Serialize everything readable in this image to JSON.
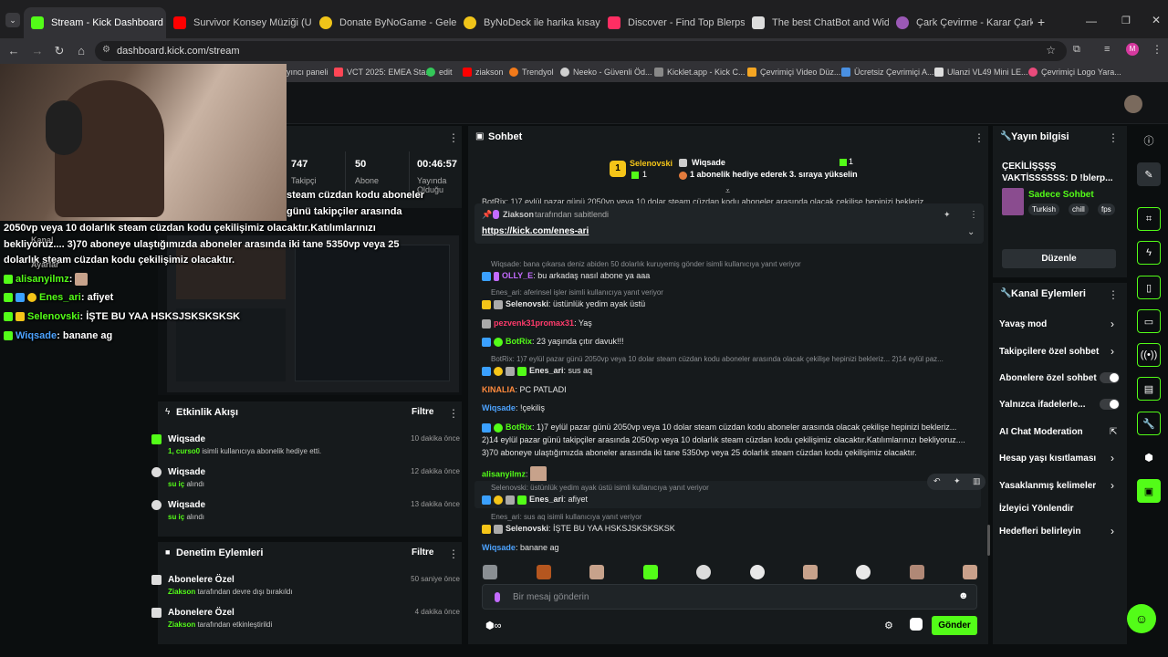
{
  "browser": {
    "tabs": [
      {
        "label": "Stream - Kick Dashboard",
        "color": "#53fc18"
      },
      {
        "label": "Survivor Konsey Müziği (Uz",
        "color": "#ff0000"
      },
      {
        "label": "Donate ByNoGame - Gelen/Gi",
        "color": "#f0c419"
      },
      {
        "label": "ByNoDeck ile harika kısayollar",
        "color": "#f0c419"
      },
      {
        "label": "Discover - Find Top Blerps, Stre",
        "color": "#ff2e63"
      },
      {
        "label": "The best ChatBot and Widgets",
        "color": "#dddddd"
      },
      {
        "label": "Çark Çevirme - Karar Çarkı!",
        "color": "#9b59b6"
      }
    ],
    "url": "dashboard.kick.com/stream",
    "bookmarks": [
      "yıncı paneli",
      "VCT 2025: EMEA Sta...",
      "edit",
      "ziakson",
      "Trendyol",
      "Neeko - Güvenli Öd...",
      "Kicklet.app - Kick C...",
      "Çevrimiçi Video Düz...",
      "Ücretsiz Çevrimiçi A...",
      "Ulanzi VL49 Mini LE...",
      "Çevrimiçi Logo Yara..."
    ]
  },
  "stats": {
    "followers_value": "747",
    "followers_label": "Takipçi",
    "subs_value": "50",
    "subs_label": "Abone",
    "uptime_value": "00:46:57",
    "uptime_label": "Yayında",
    "uptime_sub": "Olduğu"
  },
  "stream_overlay": {
    "line0": "steam cüzdan kodu aboneler",
    "line1": "günü takipçiler arasında",
    "line2": "2050vp veya 10 dolarlık steam cüzdan kodu çekilişimiz olacaktır.Katılımlarınızı",
    "line3": "bekliyoruz.... 3)70 aboneye ulaştığımızda aboneler arasında iki tane 5350vp veya 25",
    "line4": "dolarlık steam cüzdan kodu çekilişimiz olacaktır.",
    "ghost1": "Kanal",
    "ghost2": "Ayarlar",
    "chat": [
      {
        "user": "alisanyilmz",
        "text": ":",
        "color": "#53fc18"
      },
      {
        "user": "Enes_ari",
        "text": ": afiyet",
        "color": "#53fc18"
      },
      {
        "user": "Selenovski",
        "text": ": İŞTE BU YAA HSKSJSKSKSKSK",
        "color": "#53fc18"
      },
      {
        "user": "Wiqsade",
        "text": ": banane ag",
        "color": "#4da3ff"
      }
    ]
  },
  "activity": {
    "title": "Etkinlik Akışı",
    "filter": "Filtre",
    "items": [
      {
        "name": "Wiqsade",
        "sub_b": "1, curso0",
        "sub": " isimli kullanıcıya abonelik hediye etti.",
        "time": "10 dakika önce"
      },
      {
        "name": "Wiqsade",
        "sub_b": "su iç",
        "sub": " alındı",
        "time": "12 dakika önce"
      },
      {
        "name": "Wiqsade",
        "sub_b": "su iç",
        "sub": " alındı",
        "time": "13 dakika önce"
      }
    ]
  },
  "moderation": {
    "title": "Denetim Eylemleri",
    "filter": "Filtre",
    "items": [
      {
        "name": "Abonelere Özel",
        "sub_b": "Ziakson",
        "sub": " tarafından devre dışı bırakıldı",
        "time": "50 saniye önce"
      },
      {
        "name": "Abonelere Özel",
        "sub_b": "Ziakson",
        "sub": " tarafından etkinleştirildi",
        "time": "4 dakika önce"
      }
    ]
  },
  "chat": {
    "title": "Sohbet",
    "leader_user": "Selenovski",
    "leader_count": "1",
    "gifter_user": "Wiqsade",
    "gifter_count": "1",
    "gifter_text": "1 abonelik hediye ederek 3. sıraya yükselin",
    "pinned_by": "Ziakson",
    "pinned_suffix": "tarafından sabitlendi",
    "pinned_link": "https://kick.com/enes-ari",
    "top_cut": "BotRix: 1)7 eylül pazar günü 2050vp veya 10 dolar steam cüzdan kodu aboneler arasında olacak çekilişe hepinizi bekleriz...",
    "messages": [
      {
        "reply": "Wiqsade: bana çıkarsa deniz abiden 50 dolarlık kuruyemiş gönder isimli kullanıcıya yanıt veriyor",
        "user": "OLLY_E",
        "color": "#c36bff",
        "text": ": bu arkadaş nasıl abone ya aaa"
      },
      {
        "reply": "Enes_ari: aferinsel işler isimli kullanıcıya yanıt veriyor",
        "user": "Selenovski",
        "color": "#ffffff",
        "text": ": üstünlük yedim ayak üstü"
      },
      {
        "reply": "",
        "user": "pezvenk31promax31",
        "color": "#ff3b6b",
        "text": ": Yaş"
      },
      {
        "reply": "",
        "user": "BotRix",
        "color": "#53fc18",
        "text": ": 23 yaşında çıtır davuk!!!"
      },
      {
        "reply": "BotRix: 1)7 eylül pazar günü 2050vp veya 10 dolar steam cüzdan kodu aboneler arasında olacak çekilişe hepinizi bekleriz... 2)14 eylül paz...",
        "user": "Enes_ari",
        "color": "#ffffff",
        "text": ": sus aq"
      },
      {
        "reply": "",
        "user": "KINALIA",
        "color": "#ff8a3d",
        "text": ": PC PATLADI"
      },
      {
        "reply": "",
        "user": "Wiqsade",
        "color": "#4da3ff",
        "text": ": !çekiliş"
      }
    ],
    "botrix_long_user": "BotRix",
    "botrix_long_1": ": 1)7 eylül pazar günü 2050vp veya 10 dolar steam cüzdan kodu aboneler arasında olacak çekilişe hepinizi bekleriz...",
    "botrix_long_2": "2)14 eylül pazar günü takipçiler arasında 2050vp veya 10 dolarlık steam cüzdan kodu çekilişimiz olacaktır.Katılımlarınızı bekliyoruz....",
    "botrix_long_3": "3)70 aboneye ulaştığımızda aboneler arasında iki tane 5350vp veya 25 dolarlık steam cüzdan kodu çekilişimiz olacaktır.",
    "tail": [
      {
        "reply": "",
        "user": "alisanyilmz",
        "color": "#53fc18",
        "text": ":"
      },
      {
        "reply": "Selenovski: üstünlük yedim ayak üstü isimli kullanıcıya yanıt veriyor",
        "user": "Enes_ari",
        "color": "#ffffff",
        "text": ": afiyet"
      },
      {
        "reply": "Enes_ari: sus aq isimli kullanıcıya yanıt veriyor",
        "user": "Selenovski",
        "color": "#ffffff",
        "text": ": İŞTE BU YAA HSKSJSKSKSKSK"
      },
      {
        "reply": "",
        "user": "Wiqsade",
        "color": "#4da3ff",
        "text": ": banane ag"
      }
    ],
    "input_placeholder": "Bir mesaj gönderin",
    "send_label": "Gönder"
  },
  "stream_info": {
    "title": "Yayın bilgisi",
    "stream_title": "ÇEKİLİŞŞŞŞ VAKTİSSSSSS: D !blerp...",
    "category": "Sadece Sohbet",
    "tags": [
      "Turkish",
      "chill",
      "fps"
    ],
    "edit_label": "Düzenle"
  },
  "channel_actions": {
    "title": "Kanal Eylemleri",
    "items": [
      {
        "label": "Yavaş mod",
        "kind": "arrow"
      },
      {
        "label": "Takipçilere özel sohbet",
        "kind": "arrow"
      },
      {
        "label": "Abonelere özel sohbet",
        "kind": "toggle"
      },
      {
        "label": "Yalnızca ifadelerle...",
        "kind": "toggle"
      },
      {
        "label": "AI Chat Moderation",
        "kind": "external"
      },
      {
        "label": "Hesap yaşı kısıtlaması",
        "kind": "arrow"
      },
      {
        "label": "Yasaklanmış kelimeler",
        "kind": "arrow"
      },
      {
        "label": "İzleyici Yönlendir",
        "kind": "none"
      },
      {
        "label": "Hedefleri belirleyin",
        "kind": "arrow"
      }
    ]
  },
  "colors": {
    "accent": "#53fc18",
    "panel": "#161a1c",
    "bg": "#0b0e0f"
  }
}
